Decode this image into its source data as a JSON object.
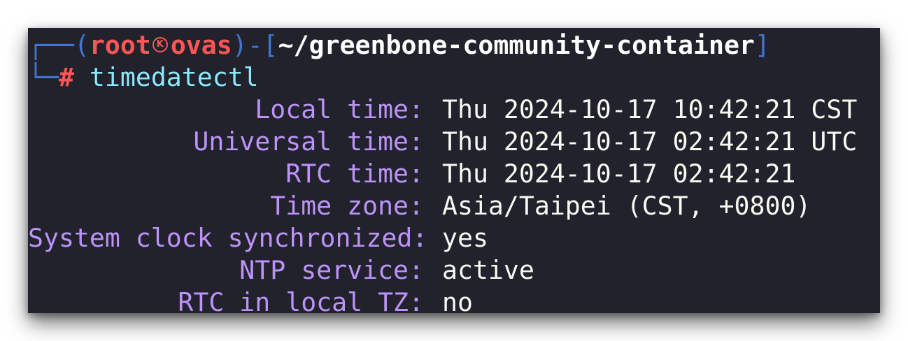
{
  "prompt": {
    "box_top": "┌──",
    "open_paren": "(",
    "user": "root",
    "separator_icon": "kali-icon",
    "host": "ovas",
    "close_paren": ")",
    "bracket_open": "-[",
    "cwd": "~/greenbone-community-container",
    "bracket_close": "]",
    "box_bottom": "└─",
    "hash": "#",
    "command": "timedatectl"
  },
  "output": {
    "rows": [
      {
        "key": "Local time:",
        "value": "Thu 2024-10-17 10:42:21 CST"
      },
      {
        "key": "Universal time:",
        "value": "Thu 2024-10-17 02:42:21 UTC"
      },
      {
        "key": "RTC time:",
        "value": "Thu 2024-10-17 02:42:21"
      },
      {
        "key": "Time zone:",
        "value": "Asia/Taipei (CST, +0800)"
      },
      {
        "key": "System clock synchronized:",
        "value": "yes"
      },
      {
        "key": "NTP service:",
        "value": "active"
      },
      {
        "key": "RTC in local TZ:",
        "value": "no"
      }
    ]
  },
  "colors": {
    "background": "#21222c",
    "box_lines": "#4573d0",
    "user_host": "#ff5555",
    "cwd": "#ffffff",
    "command": "#8be9fd",
    "keys": "#bd93f9",
    "values": "#f8f8f2"
  }
}
